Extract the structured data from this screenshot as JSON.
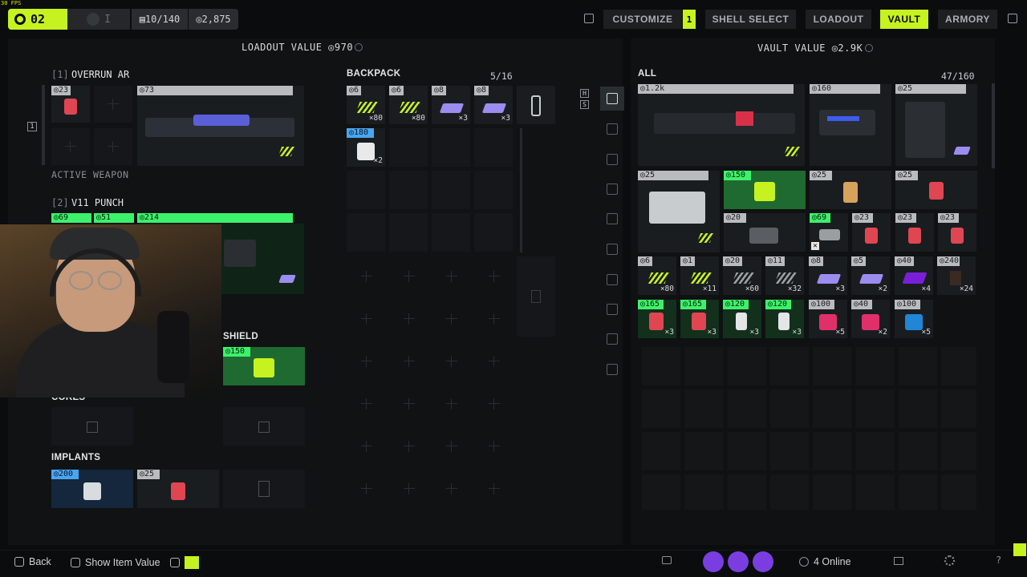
{
  "overlay": {
    "fps": "30 FPS"
  },
  "topbar": {
    "level": "02",
    "rank": "I",
    "capacity": "▤10/140",
    "credits": "◎2,875",
    "nav": [
      "CUSTOMIZE",
      "SHELL SELECT",
      "LOADOUT",
      "VAULT",
      "ARMORY"
    ],
    "customize_badge": "1",
    "active_tab": "VAULT",
    "accent": "#c6f21f"
  },
  "loadout": {
    "value_label": "LOADOUT VALUE ◎970",
    "weapon1": {
      "index": "[1]",
      "name": "OVERRUN AR",
      "mod_price": "◎23",
      "price": "◎73",
      "status": "ACTIVE WEAPON",
      "slot_marker": "1"
    },
    "weapon2": {
      "index": "[2]",
      "name": "V11 PUNCH",
      "prices": [
        "◎69",
        "◎51",
        "◎214"
      ]
    },
    "shield": {
      "label": "SHIELD",
      "price": "◎150"
    },
    "cores": {
      "label": "CORES"
    },
    "implants": {
      "label": "IMPLANTS",
      "prices": [
        "◎200",
        "◎25"
      ]
    }
  },
  "backpack": {
    "label": "BACKPACK",
    "count": "5/16",
    "items": [
      {
        "price": "◎6",
        "qty": "×80",
        "icon": "ammo-icon"
      },
      {
        "price": "◎6",
        "qty": "×80",
        "icon": "ammo-icon"
      },
      {
        "price": "◎8",
        "qty": "×3",
        "icon": "purple-cell-icon"
      },
      {
        "price": "◎8",
        "qty": "×3",
        "icon": "purple-cell-icon"
      },
      {
        "price": "◎180",
        "qty": "×2",
        "icon": "medkit-icon"
      }
    ],
    "side_labels": [
      "H",
      "S"
    ]
  },
  "vault": {
    "label": "ALL",
    "value_label": "VAULT VALUE ◎2.9K",
    "count": "47/160",
    "row1": [
      "◎1.2k",
      "◎160",
      "◎25"
    ],
    "row2": [
      "◎25",
      "◎150",
      "◎25",
      "◎25"
    ],
    "row3": [
      "◎20",
      "◎69",
      "◎23",
      "◎23",
      "◎23"
    ],
    "row4": [
      {
        "price": "◎6",
        "qty": "×80"
      },
      {
        "price": "◎1",
        "qty": "×11"
      },
      {
        "price": "◎20",
        "qty": "×60"
      },
      {
        "price": "◎11",
        "qty": "×32"
      },
      {
        "price": "◎8",
        "qty": "×3"
      },
      {
        "price": "◎5",
        "qty": "×2"
      },
      {
        "price": "◎40",
        "qty": "×4"
      },
      {
        "price": "◎240",
        "qty": "×24"
      }
    ],
    "row5": [
      {
        "price": "◎165",
        "qty": "×3"
      },
      {
        "price": "◎165",
        "qty": "×3"
      },
      {
        "price": "◎120",
        "qty": "×3"
      },
      {
        "price": "◎120",
        "qty": "×3"
      },
      {
        "price": "◎100",
        "qty": "×5"
      },
      {
        "price": "◎40",
        "qty": "×2"
      },
      {
        "price": "◎100",
        "qty": "×5"
      }
    ]
  },
  "bottom": {
    "back": "Back",
    "show_value": "Show Item Value",
    "online": "4 Online"
  }
}
